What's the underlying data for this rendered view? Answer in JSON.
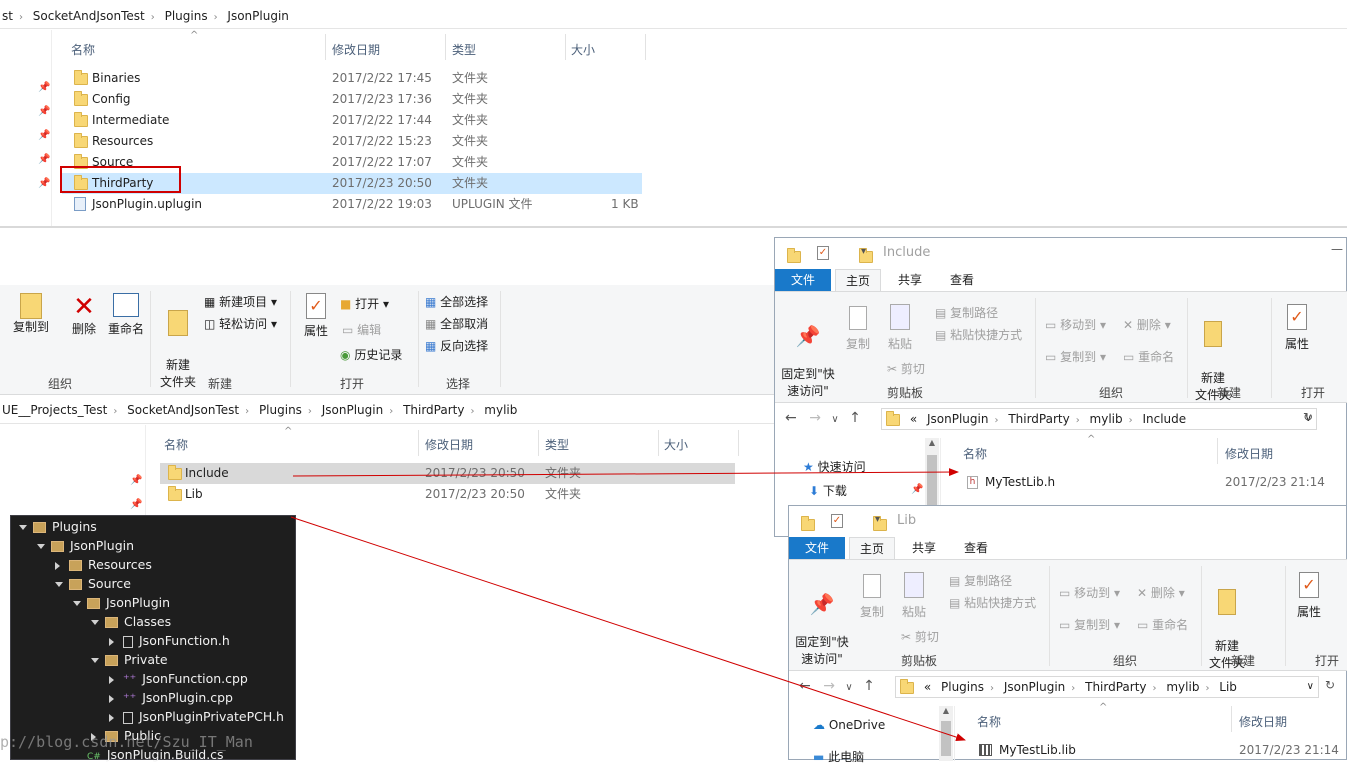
{
  "top": {
    "breadcrumb": [
      "st",
      "SocketAndJsonTest",
      "Plugins",
      "JsonPlugin"
    ],
    "headers": {
      "name": "名称",
      "date": "修改日期",
      "type": "类型",
      "size": "大小"
    },
    "rows": [
      {
        "name": "Binaries",
        "date": "2017/2/22 17:45",
        "type": "文件夹",
        "size": ""
      },
      {
        "name": "Config",
        "date": "2017/2/23 17:36",
        "type": "文件夹",
        "size": ""
      },
      {
        "name": "Intermediate",
        "date": "2017/2/22 17:44",
        "type": "文件夹",
        "size": ""
      },
      {
        "name": "Resources",
        "date": "2017/2/22 15:23",
        "type": "文件夹",
        "size": ""
      },
      {
        "name": "Source",
        "date": "2017/2/22 17:07",
        "type": "文件夹",
        "size": ""
      },
      {
        "name": "ThirdParty",
        "date": "2017/2/23 20:50",
        "type": "文件夹",
        "size": ""
      },
      {
        "name": "JsonPlugin.uplugin",
        "date": "2017/2/22 19:03",
        "type": "UPLUGIN 文件",
        "size": "1 KB"
      }
    ]
  },
  "mid": {
    "ribbon": {
      "copy_to": "复制到",
      "delete": "删除",
      "rename": "重命名",
      "new_folder": "新建\n文件夹",
      "new_item": "新建项目",
      "easy_access": "轻松访问",
      "properties": "属性",
      "open": "打开",
      "edit": "编辑",
      "history": "历史记录",
      "select_all": "全部选择",
      "select_none": "全部取消",
      "invert": "反向选择",
      "groups": {
        "organize": "组织",
        "new": "新建",
        "open": "打开",
        "select": "选择"
      }
    },
    "breadcrumb": [
      "UE__Projects_Test",
      "SocketAndJsonTest",
      "Plugins",
      "JsonPlugin",
      "ThirdParty",
      "mylib"
    ],
    "headers": {
      "name": "名称",
      "date": "修改日期",
      "type": "类型",
      "size": "大小"
    },
    "rows": [
      {
        "name": "Include",
        "date": "2017/2/23 20:50",
        "type": "文件夹"
      },
      {
        "name": "Lib",
        "date": "2017/2/23 20:50",
        "type": "文件夹"
      }
    ]
  },
  "include_win": {
    "title": "Include",
    "tabs": [
      "文件",
      "主页",
      "共享",
      "查看"
    ],
    "ribbon": {
      "pin": "固定到\"快\n速访问\"",
      "copy": "复制",
      "paste": "粘贴",
      "copy_path": "复制路径",
      "paste_shortcut": "粘贴快捷方式",
      "cut": "剪切",
      "move_to": "移动到",
      "delete": "删除",
      "copy_to": "复制到",
      "rename": "重命名",
      "new_folder": "新建\n文件夹",
      "properties": "属性",
      "clipboard": "剪贴板",
      "organize": "组织",
      "new": "新建",
      "open": "打开"
    },
    "breadcrumb": [
      "«",
      "JsonPlugin",
      "ThirdParty",
      "mylib",
      "Include"
    ],
    "nav": [
      "快速访问",
      "下载"
    ],
    "headers": {
      "name": "名称",
      "date": "修改日期"
    },
    "rows": [
      {
        "name": "MyTestLib.h",
        "date": "2017/2/23 21:14"
      }
    ]
  },
  "lib_win": {
    "title": "Lib",
    "tabs": [
      "文件",
      "主页",
      "共享",
      "查看"
    ],
    "ribbon": {
      "pin": "固定到\"快\n速访问\"",
      "copy": "复制",
      "paste": "粘贴",
      "copy_path": "复制路径",
      "paste_shortcut": "粘贴快捷方式",
      "cut": "剪切",
      "move_to": "移动到",
      "delete": "删除",
      "copy_to": "复制到",
      "rename": "重命名",
      "new_folder": "新建\n文件夹",
      "properties": "属性",
      "clipboard": "剪贴板",
      "organize": "组织",
      "new": "新建",
      "open": "打开"
    },
    "breadcrumb": [
      "«",
      "Plugins",
      "JsonPlugin",
      "ThirdParty",
      "mylib",
      "Lib"
    ],
    "nav": [
      "OneDrive",
      "此电脑"
    ],
    "headers": {
      "name": "名称",
      "date": "修改日期"
    },
    "rows": [
      {
        "name": "MyTestLib.lib",
        "date": "2017/2/23 21:14"
      }
    ]
  },
  "vs_tree": [
    {
      "label": "Plugins",
      "depth": 0,
      "kind": "folder",
      "exp": "open"
    },
    {
      "label": "JsonPlugin",
      "depth": 1,
      "kind": "folder",
      "exp": "open"
    },
    {
      "label": "Resources",
      "depth": 2,
      "kind": "folder",
      "exp": "closed"
    },
    {
      "label": "Source",
      "depth": 2,
      "kind": "folder",
      "exp": "open"
    },
    {
      "label": "JsonPlugin",
      "depth": 3,
      "kind": "folder",
      "exp": "open"
    },
    {
      "label": "Classes",
      "depth": 4,
      "kind": "folder",
      "exp": "open"
    },
    {
      "label": "JsonFunction.h",
      "depth": 5,
      "kind": "h",
      "exp": "closed"
    },
    {
      "label": "Private",
      "depth": 4,
      "kind": "folder",
      "exp": "open"
    },
    {
      "label": "JsonFunction.cpp",
      "depth": 5,
      "kind": "cpp",
      "exp": "closed"
    },
    {
      "label": "JsonPlugin.cpp",
      "depth": 5,
      "kind": "cpp",
      "exp": "closed"
    },
    {
      "label": "JsonPluginPrivatePCH.h",
      "depth": 5,
      "kind": "h",
      "exp": "closed"
    },
    {
      "label": "Public",
      "depth": 4,
      "kind": "folder",
      "exp": "closed"
    },
    {
      "label": "JsonPlugin.Build.cs",
      "depth": 3,
      "kind": "cs",
      "exp": "none"
    }
  ],
  "watermark": "p://blog.csdn.net/Szu_IT_Man",
  "colors": {
    "accent": "#1979ca",
    "highlight": "#cce8ff",
    "selected_gray": "#d9d9d9",
    "red": "#d00000"
  }
}
